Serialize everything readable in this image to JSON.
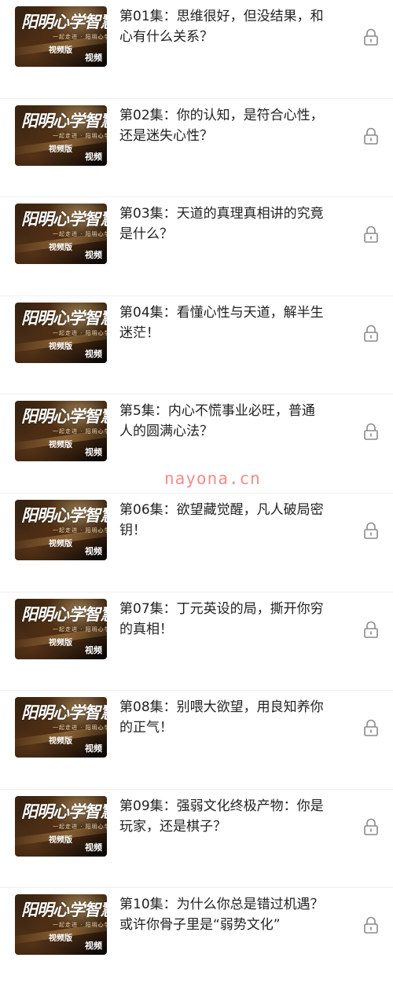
{
  "episodes": [
    {
      "title": "第01集：思维很好，但没结果，和心有什么关系？",
      "thumb_title": "阳明心学智慧",
      "thumb_subtitle": "一起走进 · 阳明心学",
      "thumb_edition": "视频版",
      "thumb_badge": "视频",
      "locked": true
    },
    {
      "title": "第02集：你的认知，是符合心性，还是迷失心性？",
      "thumb_title": "阳明心学智慧",
      "thumb_subtitle": "一起走进 · 阳明心学",
      "thumb_edition": "视频版",
      "thumb_badge": "视频",
      "locked": true
    },
    {
      "title": "第03集：天道的真理真相讲的究竟是什么？",
      "thumb_title": "阳明心学智慧",
      "thumb_subtitle": "一起走进 · 阳明心学",
      "thumb_edition": "视频版",
      "thumb_badge": "视频",
      "locked": true
    },
    {
      "title": "第04集：看懂心性与天道，解半生迷茫！",
      "thumb_title": "阳明心学智慧",
      "thumb_subtitle": "一起走进 · 阳明心学",
      "thumb_edition": "视频版",
      "thumb_badge": "视频",
      "locked": true
    },
    {
      "title": "第5集：内心不慌事业必旺，普通人的圆满心法？",
      "thumb_title": "阳明心学智慧",
      "thumb_subtitle": "一起走进 · 阳明心学",
      "thumb_edition": "视频版",
      "thumb_badge": "视频",
      "locked": true
    },
    {
      "title": "第06集：欲望藏觉醒，凡人破局密钥！",
      "thumb_title": "阳明心学智慧",
      "thumb_subtitle": "一起走进 · 阳明心学",
      "thumb_edition": "视频版",
      "thumb_badge": "视频",
      "locked": true
    },
    {
      "title": "第07集：丁元英设的局，撕开你穷的真相！",
      "thumb_title": "阳明心学智慧",
      "thumb_subtitle": "一起走进 · 阳明心学",
      "thumb_edition": "视频版",
      "thumb_badge": "视频",
      "locked": true
    },
    {
      "title": "第08集：别喂大欲望，用良知养你的正气！",
      "thumb_title": "阳明心学智慧",
      "thumb_subtitle": "一起走进 · 阳明心学",
      "thumb_edition": "视频版",
      "thumb_badge": "视频",
      "locked": true
    },
    {
      "title": "第09集：强弱文化终极产物：你是玩家，还是棋子？",
      "thumb_title": "阳明心学智慧",
      "thumb_subtitle": "一起走进 · 阳明心学",
      "thumb_edition": "视频版",
      "thumb_badge": "视频",
      "locked": true
    },
    {
      "title": "第10集：为什么你总是错过机遇？或许你骨子里是“弱势文化”",
      "thumb_title": "阳明心学智慧",
      "thumb_subtitle": "一起走进 · 阳明心学",
      "thumb_edition": "视频版",
      "thumb_badge": "视频",
      "locked": true
    }
  ],
  "watermark": "nayona.cn",
  "colors": {
    "title": "#222222",
    "lock": "#8a8a8a",
    "watermark": "#f07878",
    "divider": "#f0f0f0"
  },
  "icons": {
    "lock": "lock-icon"
  }
}
